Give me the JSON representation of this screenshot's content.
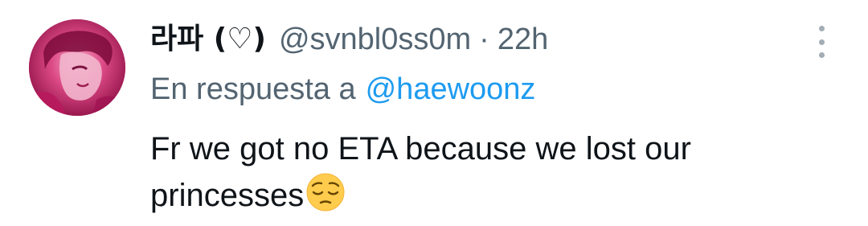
{
  "tweet": {
    "display_name": "라파 (♡)",
    "handle": "@svnbl0ss0m",
    "separator": "·",
    "time": "22h",
    "reply_prefix": "En respuesta a",
    "reply_mention": "@haewoonz",
    "text_line1": "Fr we got no ETA because we lost our",
    "text_line2": "princesses",
    "emoji": "pensive-face",
    "avatar": "profile-avatar-pink"
  },
  "colors": {
    "text_primary": "#0f1419",
    "text_secondary": "#536471",
    "link": "#1d9bf0",
    "more_dots": "#a3adb6",
    "avatar_pink": "#d83b7a"
  },
  "icons": {
    "more": "more-vertical-icon"
  }
}
